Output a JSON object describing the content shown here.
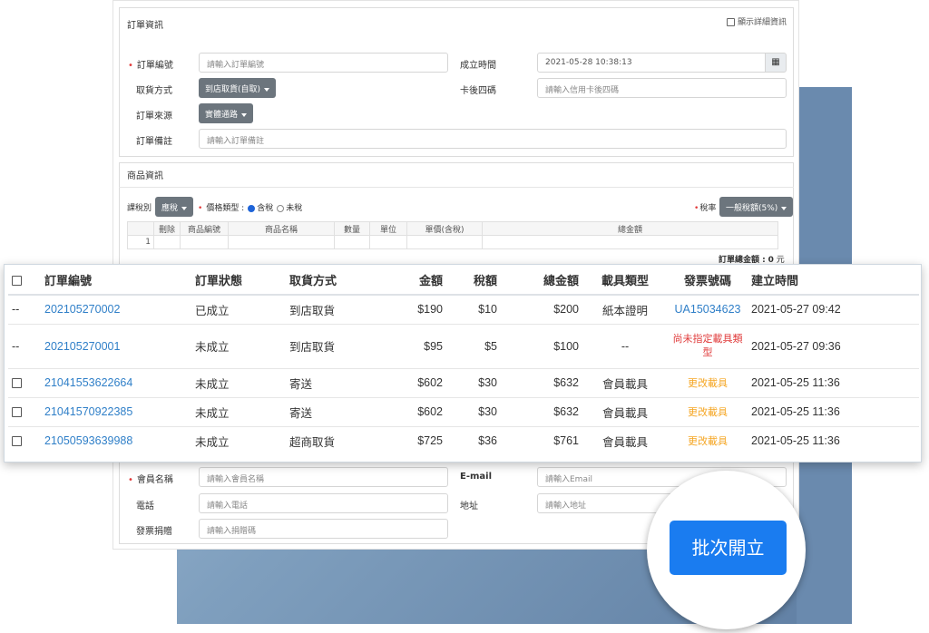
{
  "order_info": {
    "title": "訂單資訊",
    "show_details_label": "顯示詳細資訊",
    "order_no_label": "訂單編號",
    "order_no_placeholder": "請輸入訂單編號",
    "created_time_label": "成立時間",
    "created_time_value": "2021-05-28 10:38:13",
    "pickup_label": "取貨方式",
    "pickup_value": "到店取貨(自取)",
    "card_last4_label": "卡後四碼",
    "card_last4_placeholder": "請輸入信用卡後四碼",
    "source_label": "訂單來源",
    "source_value": "實體通路",
    "note_label": "訂單備註",
    "note_placeholder": "請輸入訂單備註"
  },
  "product_info": {
    "title": "商品資訊",
    "tax_type_label": "課稅別",
    "tax_type_value": "應稅",
    "price_type_label": "價格類型 :",
    "price_incl": "含稅",
    "price_excl": "未稅",
    "tax_rate_label": "稅率",
    "tax_rate_value": "一般稅額(5%)",
    "columns": [
      "刪除",
      "商品編號",
      "商品名稱",
      "數量",
      "單位",
      "單價(含稅)",
      "總金額"
    ],
    "row_index": "1",
    "total_label": "訂單總金額 :",
    "total_value": "0",
    "total_unit": "元"
  },
  "orders": {
    "headers": [
      "訂單編號",
      "訂單狀態",
      "取貨方式",
      "金額",
      "稅額",
      "總金額",
      "載具類型",
      "發票號碼",
      "建立時間"
    ],
    "rows": [
      {
        "sel": "--",
        "id": "202105270002",
        "status": "已成立",
        "pickup": "到店取貨",
        "amount": "$190",
        "tax": "$10",
        "total": "$200",
        "carrier": "紙本證明",
        "invoice": "UA15034623",
        "created": "2021-05-27 09:42"
      },
      {
        "sel": "--",
        "id": "202105270001",
        "status": "未成立",
        "pickup": "到店取貨",
        "amount": "$95",
        "tax": "$5",
        "total": "$100",
        "carrier": "--",
        "invoice": "尚未指定載具類型",
        "created": "2021-05-27 09:36"
      },
      {
        "sel": "",
        "id": "21041553622664",
        "status": "未成立",
        "pickup": "寄送",
        "amount": "$602",
        "tax": "$30",
        "total": "$632",
        "carrier": "會員載具",
        "invoice": "更改載具",
        "created": "2021-05-25 11:36"
      },
      {
        "sel": "",
        "id": "21041570922385",
        "status": "未成立",
        "pickup": "寄送",
        "amount": "$602",
        "tax": "$30",
        "total": "$632",
        "carrier": "會員載具",
        "invoice": "更改載具",
        "created": "2021-05-25 11:36"
      },
      {
        "sel": "",
        "id": "21050593639988",
        "status": "未成立",
        "pickup": "超商取貨",
        "amount": "$725",
        "tax": "$36",
        "total": "$761",
        "carrier": "會員載具",
        "invoice": "更改載具",
        "created": "2021-05-25 11:36"
      }
    ]
  },
  "member_info": {
    "name_label": "會員名稱",
    "name_placeholder": "請輸入會員名稱",
    "email_label": "E-mail",
    "email_placeholder": "請輸入Email",
    "phone_label": "電話",
    "phone_placeholder": "請輸入電話",
    "address_label": "地址",
    "address_placeholder": "請輸入地址",
    "donation_label": "發票捐贈",
    "donation_placeholder": "請輸入捐贈碼"
  },
  "batch_button_label": "批次開立",
  "icons": {
    "calendar": "calendar-icon",
    "caret": "caret-down-icon"
  },
  "colors": {
    "link": "#2f7fc8",
    "warning": "#e03b3b",
    "amber": "#f5a623",
    "button": "#1a7cf0",
    "dropdown": "#6c757d"
  }
}
